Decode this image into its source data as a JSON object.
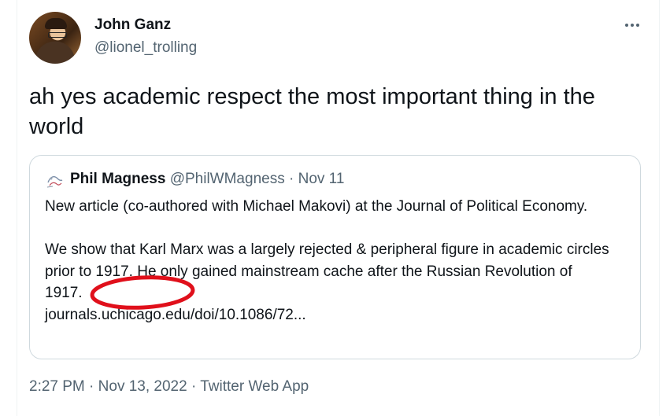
{
  "author": {
    "name": "John Ganz",
    "handle": "@lionel_trolling"
  },
  "tweet": {
    "text": "ah yes academic respect the most important thing in the world"
  },
  "quoted": {
    "name": "Phil Magness",
    "handle": "@PhilWMagness",
    "separator": " · ",
    "date": "Nov 11",
    "paragraph1": "New article (co-authored with Michael Makovi) at the Journal of Political Economy.",
    "paragraph2": "We show that Karl Marx was a largely rejected & peripheral figure in academic circles prior to 1917. He only gained mainstream cache after the Russian Revolution of 1917.",
    "link": "journals.uchicago.edu/doi/10.1086/72..."
  },
  "meta": {
    "time": "2:27 PM",
    "date": "Nov 13, 2022",
    "source": "Twitter Web App",
    "separator": " · "
  },
  "icons": {
    "more": "more-dots-icon",
    "avatar": "user-avatar",
    "quoted_avatar": "quoted-user-avatar"
  },
  "colors": {
    "text": "#0f1419",
    "secondary": "#536471",
    "border": "#cfd9de",
    "annotation": "#e0101b"
  }
}
